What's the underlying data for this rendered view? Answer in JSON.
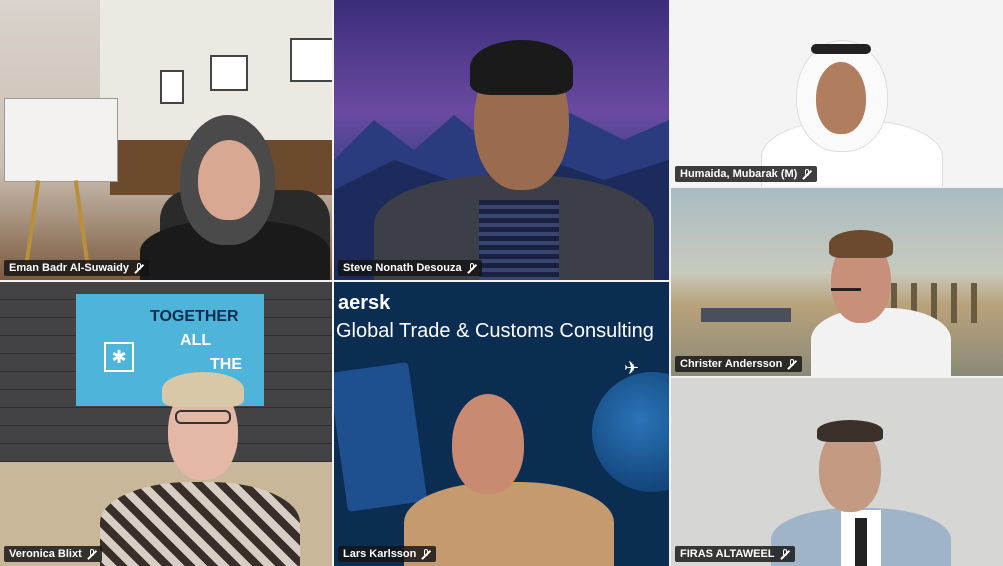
{
  "participants": [
    {
      "name": "Eman Badr Al-Suwaidy",
      "mic_icon": "mic-muted-icon"
    },
    {
      "name": "Steve Nonath Desouza",
      "mic_icon": "mic-muted-icon"
    },
    {
      "name": "Humaida, Mubarak (M)",
      "mic_icon": "mic-muted-icon"
    },
    {
      "name": "Christer Andersson",
      "mic_icon": "mic-muted-icon"
    },
    {
      "name": "Veronica Blixt",
      "mic_icon": "mic-muted-icon"
    },
    {
      "name": "Lars Karlsson",
      "mic_icon": "mic-muted-icon"
    },
    {
      "name": "FIRAS ALTAWEEL",
      "mic_icon": "mic-muted-icon"
    }
  ],
  "backgrounds": {
    "together_sign": [
      "TOGETHER",
      "ALL",
      "THE"
    ],
    "maersk_brand": "aersk",
    "maersk_tagline": "Global Trade & Customs Consulting"
  },
  "colors": {
    "name_label_bg": "#141414",
    "maersk_blue": "#0c2d52",
    "sign_blue": "#42b0d5"
  }
}
